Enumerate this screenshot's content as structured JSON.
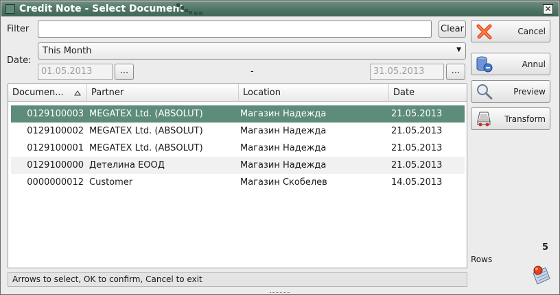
{
  "window": {
    "title": "Credit Note - Select Document",
    "close_label": "✕"
  },
  "filter": {
    "label": "Filter",
    "value": "",
    "clear_label": "Clear"
  },
  "date": {
    "label": "Date:",
    "period": "This Month",
    "from": "01.05.2013",
    "to": "31.05.2013",
    "separator": "-",
    "picker_label": "..."
  },
  "grid": {
    "columns": [
      "Documen...",
      "Partner",
      "Location",
      "Date"
    ],
    "rows": [
      {
        "document": "0129100003",
        "partner": "MEGATEX Ltd. (ABSOLUT)",
        "location": "Магазин Надежда",
        "date": "21.05.2013"
      },
      {
        "document": "0129100002",
        "partner": "MEGATEX Ltd. (ABSOLUT)",
        "location": "Магазин Надежда",
        "date": "21.05.2013"
      },
      {
        "document": "0129100001",
        "partner": "MEGATEX Ltd. (ABSOLUT)",
        "location": "Магазин Надежда",
        "date": "21.05.2013"
      },
      {
        "document": "0129100000",
        "partner": "Детелина ЕООД",
        "location": "Магазин Надежда",
        "date": "21.05.2013"
      },
      {
        "document": "0000000012",
        "partner": "Customer",
        "location": "Магазин Скобелев",
        "date": "14.05.2013"
      }
    ],
    "selected_row": 0
  },
  "actions": {
    "cancel": "Cancel",
    "annul": "Annul",
    "preview": "Preview",
    "transform": "Transform"
  },
  "rows_info": {
    "count": "5",
    "label": "Rows"
  },
  "status": {
    "text": "Arrows to select, OK to confirm, Cancel to exit"
  },
  "colors": {
    "title_bar": "#4d7464",
    "selected_row": "#5e8c7a"
  },
  "icons": {
    "cancel": "red-x-icon",
    "annul": "database-icon",
    "preview": "magnifier-icon",
    "transform": "transform-document-icon",
    "scroll": "scroll-icon"
  }
}
